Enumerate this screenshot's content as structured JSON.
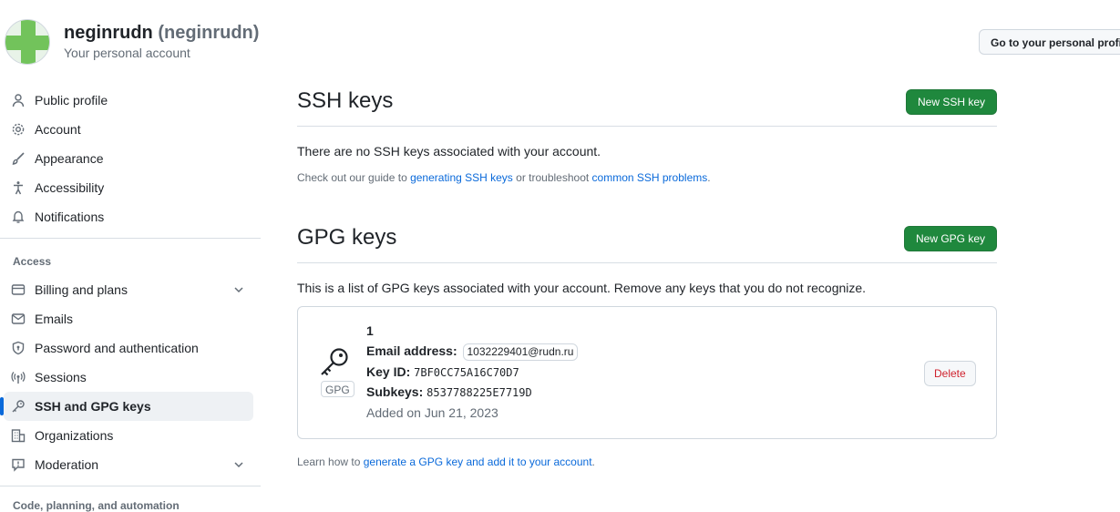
{
  "header": {
    "display_name": "neginrudn",
    "login": "(neginrudn)",
    "subtitle": "Your personal account",
    "profile_button": "Go to your personal profile"
  },
  "sidebar": {
    "items": [
      {
        "label": "Public profile",
        "icon": "person-icon"
      },
      {
        "label": "Account",
        "icon": "gear-icon"
      },
      {
        "label": "Appearance",
        "icon": "paintbrush-icon"
      },
      {
        "label": "Accessibility",
        "icon": "accessibility-icon"
      },
      {
        "label": "Notifications",
        "icon": "bell-icon"
      }
    ],
    "access_label": "Access",
    "access_items": [
      {
        "label": "Billing and plans",
        "icon": "credit-card-icon",
        "expandable": true
      },
      {
        "label": "Emails",
        "icon": "mail-icon"
      },
      {
        "label": "Password and authentication",
        "icon": "shield-lock-icon"
      },
      {
        "label": "Sessions",
        "icon": "broadcast-icon"
      },
      {
        "label": "SSH and GPG keys",
        "icon": "key-icon",
        "active": true
      },
      {
        "label": "Organizations",
        "icon": "organization-icon"
      },
      {
        "label": "Moderation",
        "icon": "report-icon",
        "expandable": true
      }
    ],
    "next_group_label": "Code, planning, and automation"
  },
  "ssh": {
    "title": "SSH keys",
    "new_button": "New SSH key",
    "empty_text": "There are no SSH keys associated with your account.",
    "guide_prefix": "Check out our guide to ",
    "guide_link": "generating SSH keys",
    "guide_middle": " or troubleshoot ",
    "guide_link2": "common SSH problems",
    "guide_suffix": "."
  },
  "gpg": {
    "title": "GPG keys",
    "new_button": "New GPG key",
    "intro": "This is a list of GPG keys associated with your account. Remove any keys that you do not recognize.",
    "key": {
      "name": "1",
      "badge": "GPG",
      "email_label": "Email address:",
      "email": "1032229401@rudn.ru",
      "keyid_label": "Key ID:",
      "keyid": "7BF0CC75A16C70D7",
      "subkeys_label": "Subkeys:",
      "subkeys": "8537788225E7719D",
      "added": "Added on Jun 21, 2023",
      "delete_button": "Delete"
    },
    "learn_prefix": "Learn how to ",
    "learn_link": "generate a GPG key and add it to your account",
    "learn_suffix": "."
  },
  "colors": {
    "accent": "#0969da",
    "primary_button": "#1f883d",
    "danger": "#cf222e",
    "muted": "#636c76"
  }
}
